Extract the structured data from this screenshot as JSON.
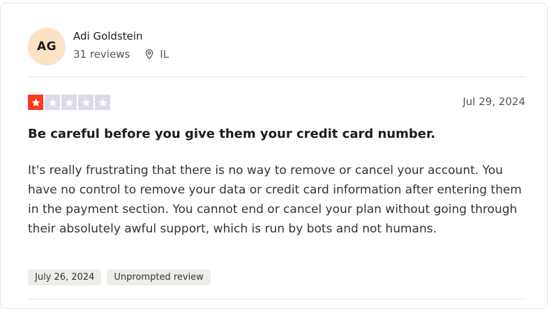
{
  "reviewer": {
    "initials": "AG",
    "name": "Adi Goldstein",
    "reviews_count": "31 reviews",
    "location": "IL"
  },
  "review": {
    "rating": 1,
    "max_rating": 5,
    "date": "Jul 29, 2024",
    "title": "Be careful before you give them your credit card number.",
    "body": "It's really frustrating that there is no way to remove or cancel your account. You have no control to remove your data or credit card information after entering them in the payment section. You cannot end or cancel your plan without going through their absolutely awful support, which is run by bots and not humans.",
    "tags": [
      "July 26, 2024",
      "Unprompted review"
    ]
  },
  "colors": {
    "star_filled": "#ff3722",
    "star_empty": "#dcdce6",
    "avatar_bg": "#fde3c4"
  },
  "icons": {
    "location": "location-pin-icon",
    "star": "star-icon"
  }
}
